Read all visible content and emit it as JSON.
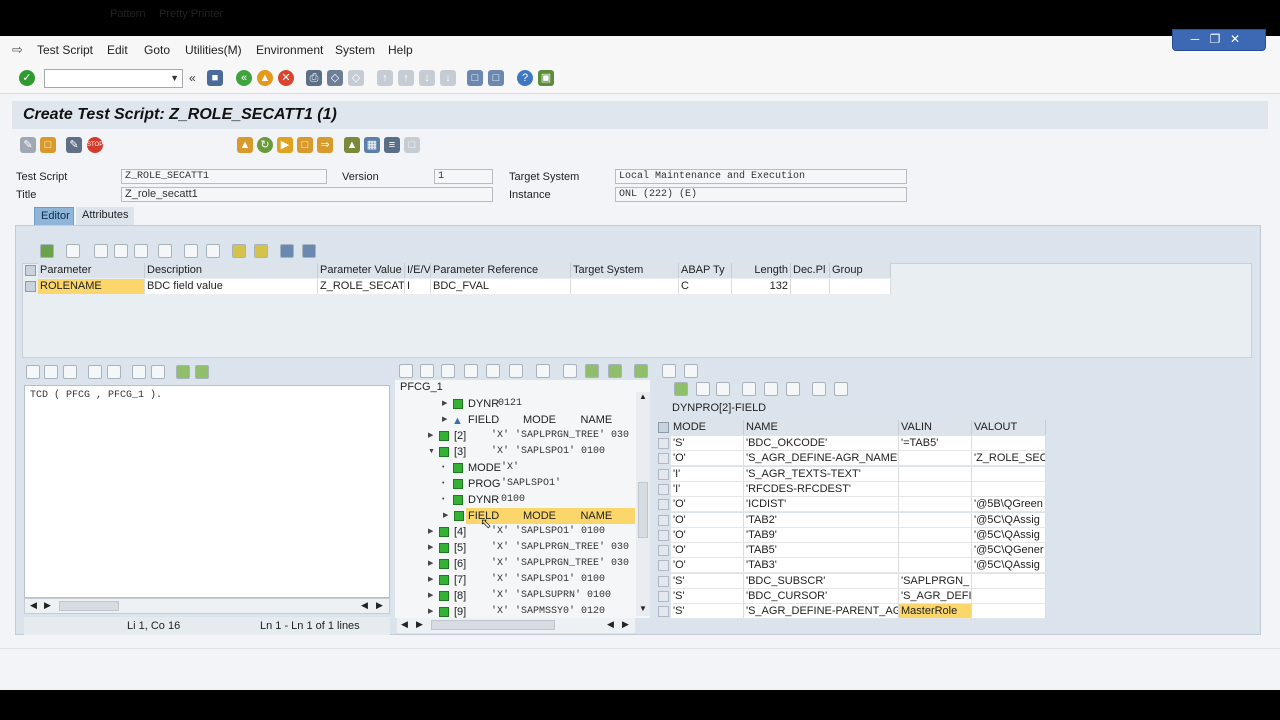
{
  "menu": {
    "items": [
      "Test Script",
      "Edit",
      "Goto",
      "Utilities(M)",
      "Environment",
      "System",
      "Help"
    ]
  },
  "window_controls": [
    "minimize-icon",
    "restore-icon",
    "close-icon"
  ],
  "toolbar": {
    "command_value": ""
  },
  "title": "Create Test Script: Z_ROLE_SECATT1 (1)",
  "app_toolbar": {
    "pattern": "Pattern",
    "pretty_printer": "Pretty Printer"
  },
  "header": {
    "test_script_label": "Test Script",
    "test_script_value": "Z_ROLE_SECATT1",
    "version_label": "Version",
    "version_value": "1",
    "target_system_label": "Target System",
    "target_system_value": "Local Maintenance and Execution",
    "title_label": "Title",
    "title_value": "Z_role_secatt1",
    "instance_label": "Instance",
    "instance_value": "ONL (222) (E)"
  },
  "tabs": {
    "editor": "Editor",
    "attributes": "Attributes"
  },
  "params": {
    "headers": [
      "Parameter",
      "Description",
      "Parameter Value",
      "I/E/V",
      "Parameter Reference",
      "Target System",
      "ABAP Ty",
      "Length",
      "Dec.Pl",
      "Group"
    ],
    "row": [
      "ROLENAME",
      "BDC field value",
      "Z_ROLE_SECAT",
      "I",
      "BDC_FVAL",
      "",
      "C",
      "132",
      "",
      ""
    ]
  },
  "editor": {
    "code": "TCD ( PFCG , PFCG_1 ).",
    "status_pos": "Li 1, Co 16",
    "status_lines": "Ln 1 - Ln 1 of 1 lines"
  },
  "tree": {
    "root": "PFCG_1",
    "rows": [
      {
        "label": "DYNR",
        "value": "0121"
      },
      {
        "label": "FIELD",
        "value": "MODE        NAME"
      },
      {
        "label": "[2]",
        "value": "'X' 'SAPLPRGN_TREE' 030"
      },
      {
        "label": "[3]",
        "value": "'X' 'SAPLSPO1' 0100"
      },
      {
        "label": "MODE",
        "value": "'X'"
      },
      {
        "label": "PROG",
        "value": "'SAPLSPO1'"
      },
      {
        "label": "DYNR",
        "value": "0100"
      },
      {
        "label": "FIELD",
        "value": "MODE        NAME"
      },
      {
        "label": "[4]",
        "value": "'X' 'SAPLSPO1' 0100"
      },
      {
        "label": "[5]",
        "value": "'X' 'SAPLPRGN_TREE' 030"
      },
      {
        "label": "[6]",
        "value": "'X' 'SAPLPRGN_TREE' 030"
      },
      {
        "label": "[7]",
        "value": "'X' 'SAPLSPO1' 0100"
      },
      {
        "label": "[8]",
        "value": "'X' 'SAPLSUPRN' 0100"
      },
      {
        "label": "[9]",
        "value": "'X' 'SAPMSSY0' 0120"
      }
    ]
  },
  "dynpro": {
    "label": "DYNPRO[2]-FIELD",
    "headers": [
      "MODE",
      "NAME",
      "VALIN",
      "VALOUT"
    ],
    "rows": [
      [
        "'S'",
        "'BDC_OKCODE'",
        "'=TAB5'",
        ""
      ],
      [
        "'O'",
        "'S_AGR_DEFINE-AGR_NAME'",
        "",
        "'Z_ROLE_SEC"
      ],
      [
        "'I'",
        "'S_AGR_TEXTS-TEXT'",
        "",
        ""
      ],
      [
        "'I'",
        "'RFCDES-RFCDEST'",
        "",
        ""
      ],
      [
        "'O'",
        "'ICDIST'",
        "",
        "'@5B\\QGreen"
      ],
      [
        "'O'",
        "'TAB2'",
        "",
        "'@5C\\QAssig"
      ],
      [
        "'O'",
        "'TAB9'",
        "",
        "'@5C\\QAssig"
      ],
      [
        "'O'",
        "'TAB5'",
        "",
        "'@5C\\QGener"
      ],
      [
        "'O'",
        "'TAB3'",
        "",
        "'@5C\\QAssig"
      ],
      [
        "'S'",
        "'BDC_SUBSCR'",
        "'SAPLPRGN_",
        ""
      ],
      [
        "'S'",
        "'BDC_CURSOR'",
        "'S_AGR_DEFI",
        ""
      ],
      [
        "'S'",
        "'S_AGR_DEFINE-PARENT_AGR'",
        "MasterRole",
        ""
      ]
    ]
  },
  "colors": {
    "accent": "#8fb6d8",
    "selection": "#fbd66a",
    "tree_node": "#33b233",
    "window_bar": "#3d68b3"
  }
}
